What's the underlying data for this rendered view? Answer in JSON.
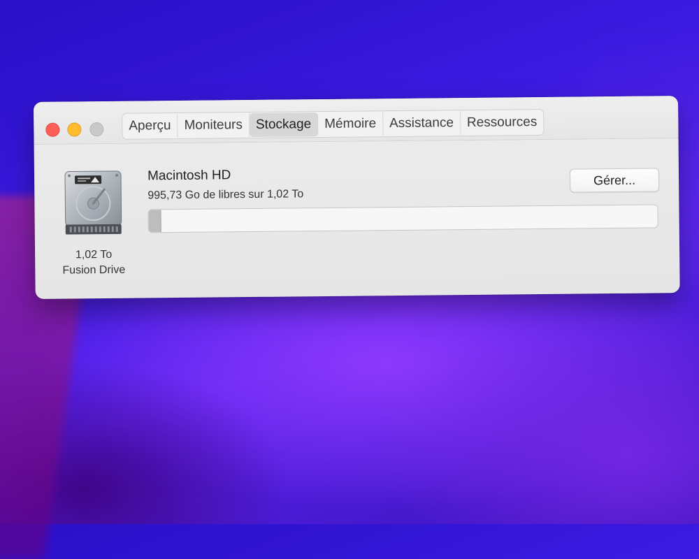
{
  "window": {
    "tabs": [
      {
        "label": "Aperçu",
        "active": false
      },
      {
        "label": "Moniteurs",
        "active": false
      },
      {
        "label": "Stockage",
        "active": true
      },
      {
        "label": "Mémoire",
        "active": false
      },
      {
        "label": "Assistance",
        "active": false
      },
      {
        "label": "Ressources",
        "active": false
      }
    ]
  },
  "disk": {
    "icon": "hard-drive-icon",
    "capacity": "1,02 To",
    "type": "Fusion Drive"
  },
  "volume": {
    "name": "Macintosh HD",
    "free_text": "995,73 Go de libres sur 1,02 To",
    "used_fraction": 0.024,
    "manage_label": "Gérer..."
  },
  "colors": {
    "close": "#ff5f57",
    "minimize": "#febc2e",
    "zoom": "#c9c9c9"
  }
}
